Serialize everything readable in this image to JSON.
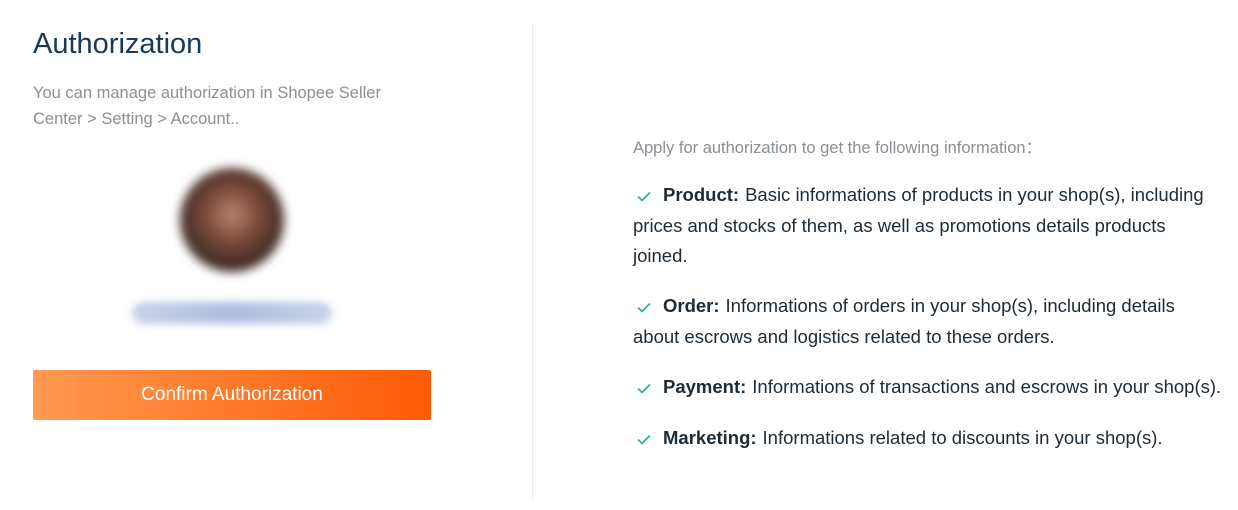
{
  "left": {
    "title": "Authorization",
    "subtitle": "You can manage authorization in Shopee Seller Center > Setting > Account..",
    "confirm_label": "Confirm Authorization"
  },
  "right": {
    "intro": "Apply for authorization to get the following information：",
    "items": [
      {
        "title": "Product:",
        "desc": "Basic informations of products in your shop(s), including prices and stocks of them, as well as promotions details products joined."
      },
      {
        "title": "Order:",
        "desc": "Informations of orders in your shop(s), including details about escrows and logistics related to these orders."
      },
      {
        "title": "Payment:",
        "desc": "Informations of transactions and escrows in your shop(s)."
      },
      {
        "title": "Marketing:",
        "desc": "Informations related to discounts in your shop(s)."
      }
    ]
  },
  "colors": {
    "title": "#173a5a",
    "muted_text": "#8a9095",
    "check": "#26aa99",
    "button_start": "#ff9a52",
    "button_end": "#fe5a05"
  }
}
